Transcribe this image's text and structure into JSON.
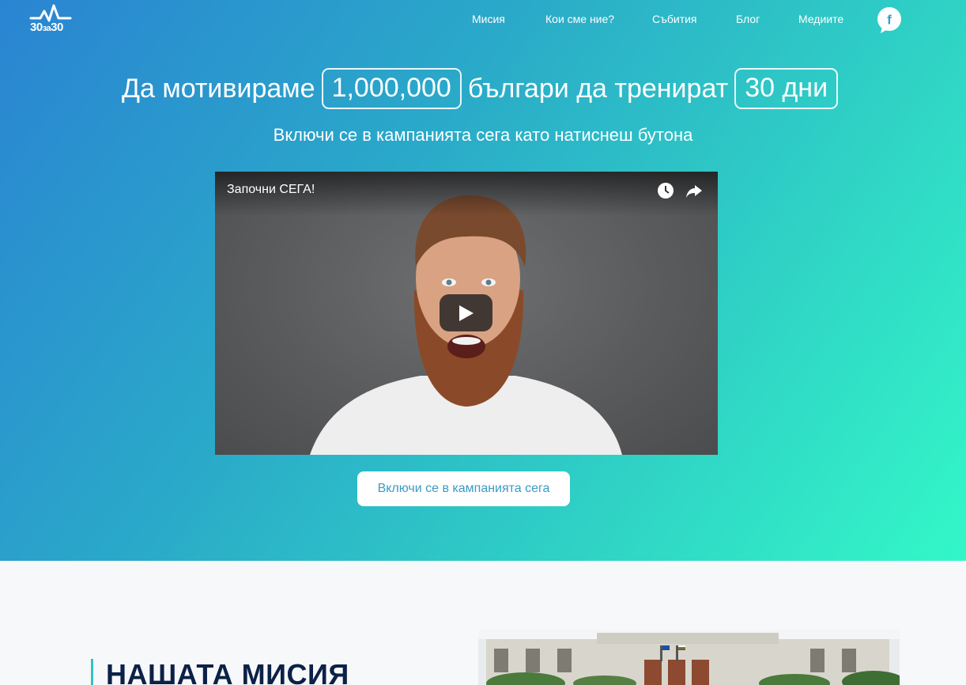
{
  "header": {
    "logo_text_left": "30",
    "logo_text_mid": "за",
    "logo_text_right": "30",
    "nav": [
      {
        "label": "Мисия"
      },
      {
        "label": "Кои сме ние?"
      },
      {
        "label": "Събития"
      },
      {
        "label": "Блог"
      },
      {
        "label": "Медиите"
      }
    ],
    "social_icon": "facebook-icon"
  },
  "hero": {
    "headline_part1": "Да мотивираме",
    "headline_number": "1,000,000",
    "headline_part2": "българи да тренират",
    "headline_days": "30 дни",
    "subheadline": "Включи се в кампанията сега като натиснеш бутона",
    "cta_label": "Включи се в кампанията сега"
  },
  "video": {
    "title": "Започни СЕГА!",
    "icons": [
      "clock-icon",
      "share-icon",
      "play-icon"
    ]
  },
  "mission": {
    "title": "НАШАТА МИСИЯ"
  },
  "colors": {
    "gradient_start": "#2a84d2",
    "gradient_end": "#33f7c8",
    "cta_text": "#3a9bc4",
    "mission_title": "#0c2147",
    "accent": "#2fc4c1"
  }
}
